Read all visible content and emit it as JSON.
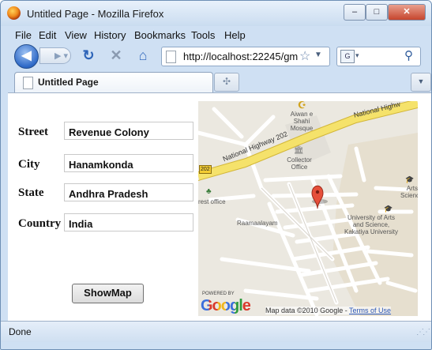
{
  "window": {
    "title": "Untitled Page - Mozilla Firefox",
    "controls": {
      "minimize": "–",
      "maximize": "□",
      "close": "✕"
    }
  },
  "menu": [
    {
      "label": "File"
    },
    {
      "label": "Edit"
    },
    {
      "label": "View"
    },
    {
      "label": "History"
    },
    {
      "label": "Bookmarks"
    },
    {
      "label": "Tools"
    },
    {
      "label": "Help"
    }
  ],
  "navbar": {
    "back_icon": "back-arrow-icon",
    "forward_icon": "forward-arrow-icon",
    "reload_icon": "reload-icon",
    "stop_icon": "stop-icon",
    "home_icon": "home-icon",
    "url": "http://localhost:22245/gm",
    "search_value": ""
  },
  "tabs": [
    {
      "label": "Untitled Page"
    }
  ],
  "form": {
    "street_label": "Street",
    "street_value": "Revenue Colony",
    "city_label": "City",
    "city_value": "Hanamkonda",
    "state_label": "State",
    "state_value": "Andhra Pradesh",
    "country_label": "Country",
    "country_value": "India",
    "button_label": "ShowMap"
  },
  "map": {
    "labels": {
      "mosque": "Aiwan e Shahi Mosque",
      "highway_a": "National Highway 202",
      "highway_b": "National Highw",
      "shield": "202",
      "collector": "Collector Office",
      "post_office": "rest office",
      "science": "Arts Science",
      "university": "University of Arts and Science, Kakatiya University",
      "ramaalayam": "Raamaalayam"
    },
    "powered_by": "POWERED BY",
    "logo": "Google",
    "attribution": "Map data ©2010 Google - ",
    "terms": "Terms of Use"
  },
  "status": {
    "text": "Done"
  }
}
